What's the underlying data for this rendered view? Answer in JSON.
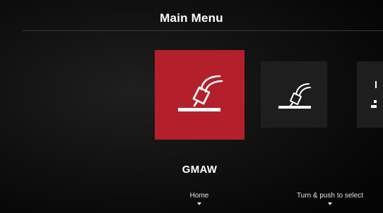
{
  "header": {
    "title": "Main Menu"
  },
  "menu": {
    "items": [
      {
        "icon": "gmaw-torch-icon",
        "selected": true
      },
      {
        "icon": "welding-torch-icon",
        "selected": false
      },
      {
        "icon": "partial-menu-icon",
        "selected": false
      }
    ],
    "selected_label": "GMAW"
  },
  "footer": {
    "home_label": "Home",
    "select_label": "Turn & push to select"
  },
  "colors": {
    "selected_tile": "#b3202c",
    "tile": "#1e1e1e",
    "background": "#0d0d0d",
    "text": "#ffffff"
  }
}
